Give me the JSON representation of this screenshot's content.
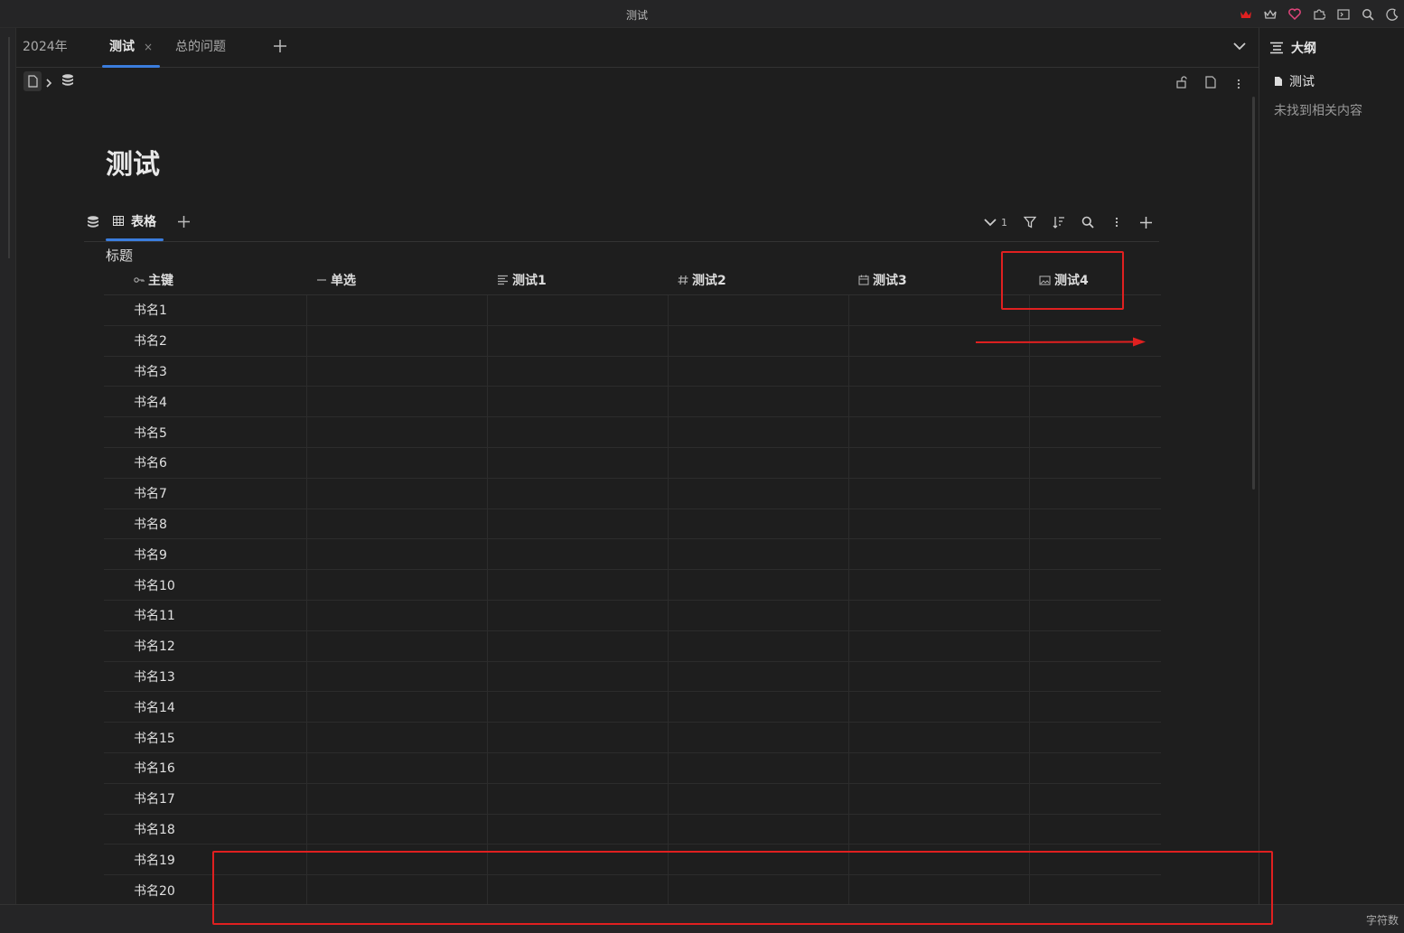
{
  "window": {
    "title": "测试"
  },
  "tabs": [
    {
      "label": "2024年"
    },
    {
      "label": "测试",
      "close": "×"
    },
    {
      "label": "总的问题"
    }
  ],
  "doc": {
    "title": "测试"
  },
  "view": {
    "tab_label": "表格",
    "count": "1"
  },
  "table": {
    "title": "标题",
    "columns": [
      {
        "label": "主键",
        "icon": "key-icon"
      },
      {
        "label": "单选",
        "icon": "single-select-icon"
      },
      {
        "label": "测试1",
        "icon": "text-icon"
      },
      {
        "label": "测试2",
        "icon": "hash-icon"
      },
      {
        "label": "测试3",
        "icon": "calendar-icon"
      },
      {
        "label": "测试4",
        "icon": "image-icon"
      }
    ],
    "rows": [
      "书名1",
      "书名2",
      "书名3",
      "书名4",
      "书名5",
      "书名6",
      "书名7",
      "书名8",
      "书名9",
      "书名10",
      "书名11",
      "书名12",
      "书名13",
      "书名14",
      "书名15",
      "书名16",
      "书名17",
      "书名18",
      "书名19",
      "书名20"
    ]
  },
  "outline": {
    "title": "大纲",
    "item": "测试",
    "empty": "未找到相关内容"
  },
  "status": {
    "word_count": "字符数"
  },
  "colors": {
    "accent": "#3b7ddd",
    "annotation": "#e02020",
    "background": "#1e1e1e"
  }
}
